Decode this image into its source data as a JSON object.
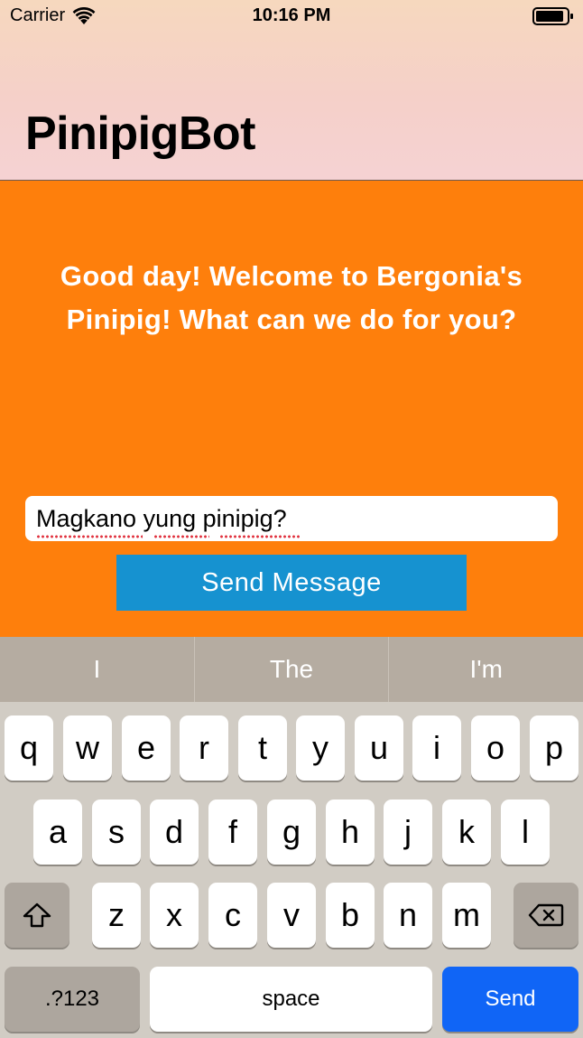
{
  "status_bar": {
    "carrier": "Carrier",
    "time": "10:16 PM",
    "wifi_icon": "wifi-icon",
    "battery_icon": "battery-icon"
  },
  "nav": {
    "title": "PinipigBot"
  },
  "chat": {
    "welcome_line1": "Good day! Welcome to Bergonia's",
    "welcome_line2": "Pinipig! What can we do for you?",
    "input_value": "Magkano yung pinipig?",
    "send_button_label": "Send Message"
  },
  "keyboard": {
    "predictions": [
      "I",
      "The",
      "I'm"
    ],
    "row1": [
      "q",
      "w",
      "e",
      "r",
      "t",
      "y",
      "u",
      "i",
      "o",
      "p"
    ],
    "row2": [
      "a",
      "s",
      "d",
      "f",
      "g",
      "h",
      "j",
      "k",
      "l"
    ],
    "row3": [
      "z",
      "x",
      "c",
      "v",
      "b",
      "n",
      "m"
    ],
    "shift_icon": "shift-icon",
    "delete_icon": "delete-icon",
    "numbers_label": ".?123",
    "space_label": "space",
    "send_label": "Send"
  },
  "colors": {
    "content_background": "#fe7f0c",
    "send_message_button": "#1692d0",
    "keyboard_send_key": "#1065f6"
  }
}
